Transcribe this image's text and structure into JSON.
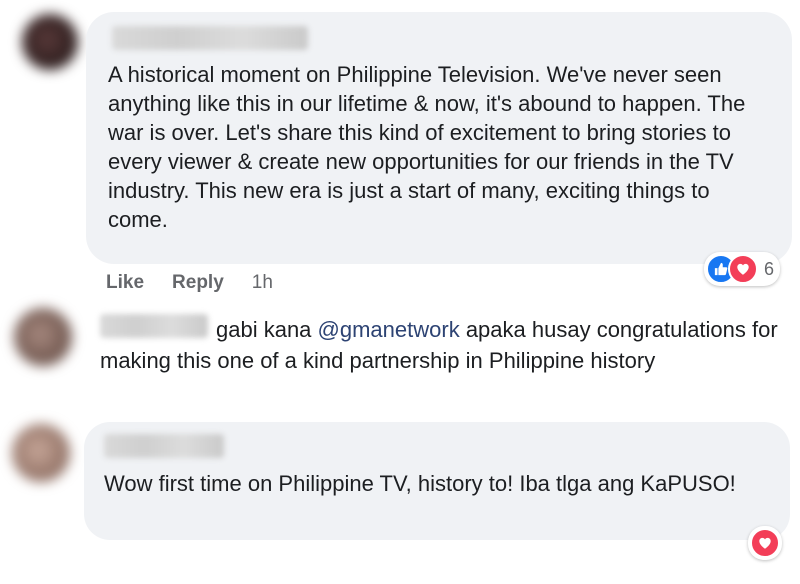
{
  "comments": [
    {
      "text": "A historical moment on Philippine Television. We've never seen anything like this in our lifetime & now, it's abound to happen. The war is over. Let's share this kind of excitement to bring stories to every viewer & create new opportunities for our friends in the TV industry. This new era is just a start of many, exciting things to come.",
      "actions": {
        "like": "Like",
        "reply": "Reply",
        "time": "1h"
      },
      "reaction_count": "6",
      "reactions": [
        "like-icon",
        "love-icon"
      ]
    },
    {
      "text_prefix": "gabi kana ",
      "mention": "@gmanetwork",
      "text_suffix": " apaka husay congratulations for making this one of a kind partnership in Philippine history"
    },
    {
      "text": "Wow first time on Philippine TV, history to! Iba tlga ang KaPUSO!",
      "reactions": [
        "love-icon"
      ]
    }
  ],
  "colors": {
    "bubble": "#f0f2f5",
    "text": "#1c1e21",
    "meta": "#65676b",
    "mention": "#2d4373",
    "like": "#1877f2",
    "love": "#f33e58"
  }
}
